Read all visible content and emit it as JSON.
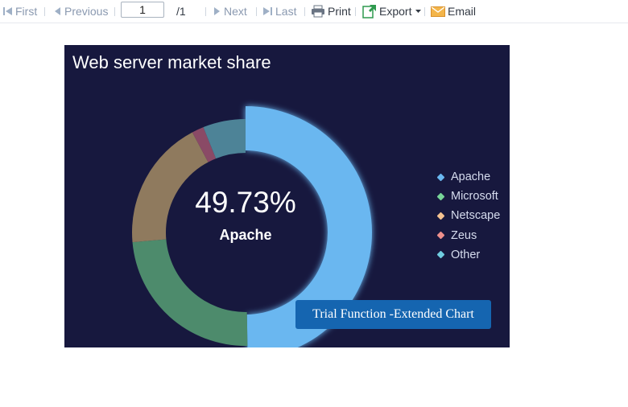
{
  "toolbar": {
    "first_label": "First",
    "previous_label": "Previous",
    "page_value": "1",
    "page_total": "/1",
    "next_label": "Next",
    "last_label": "Last",
    "print_label": "Print",
    "export_label": "Export",
    "email_label": "Email",
    "icons": {
      "first": "first-page-icon",
      "previous": "prev-page-icon",
      "next": "next-page-icon",
      "last": "last-page-icon",
      "print": "printer-icon",
      "export": "export-icon",
      "export_caret": "caret-down-icon",
      "email": "envelope-icon"
    }
  },
  "chart_data": {
    "type": "pie",
    "title": "Web server market share",
    "center": {
      "value": "49.73%",
      "label": "Apache"
    },
    "series": [
      {
        "name": "Apache",
        "value": 49.73,
        "color": "#6ab7f0"
      },
      {
        "name": "Microsoft",
        "value": 23.9,
        "color": "#4d8b6c"
      },
      {
        "name": "Netscape",
        "value": 18.6,
        "color": "#8f7a5e"
      },
      {
        "name": "Zeus",
        "value": 1.7,
        "color": "#8a4a66"
      },
      {
        "name": "Other",
        "value": 6.07,
        "color": "#4d8397"
      }
    ],
    "legend_markers": [
      "#6ab7f0",
      "#77d498",
      "#f5c391",
      "#ee908c",
      "#70cde0"
    ],
    "legend_placement": "right",
    "grid": false
  },
  "overlay": {
    "trial_text": "Trial Function -Extended Chart"
  },
  "colors": {
    "chart_background": "#17183e",
    "badge": "#1565b0"
  }
}
